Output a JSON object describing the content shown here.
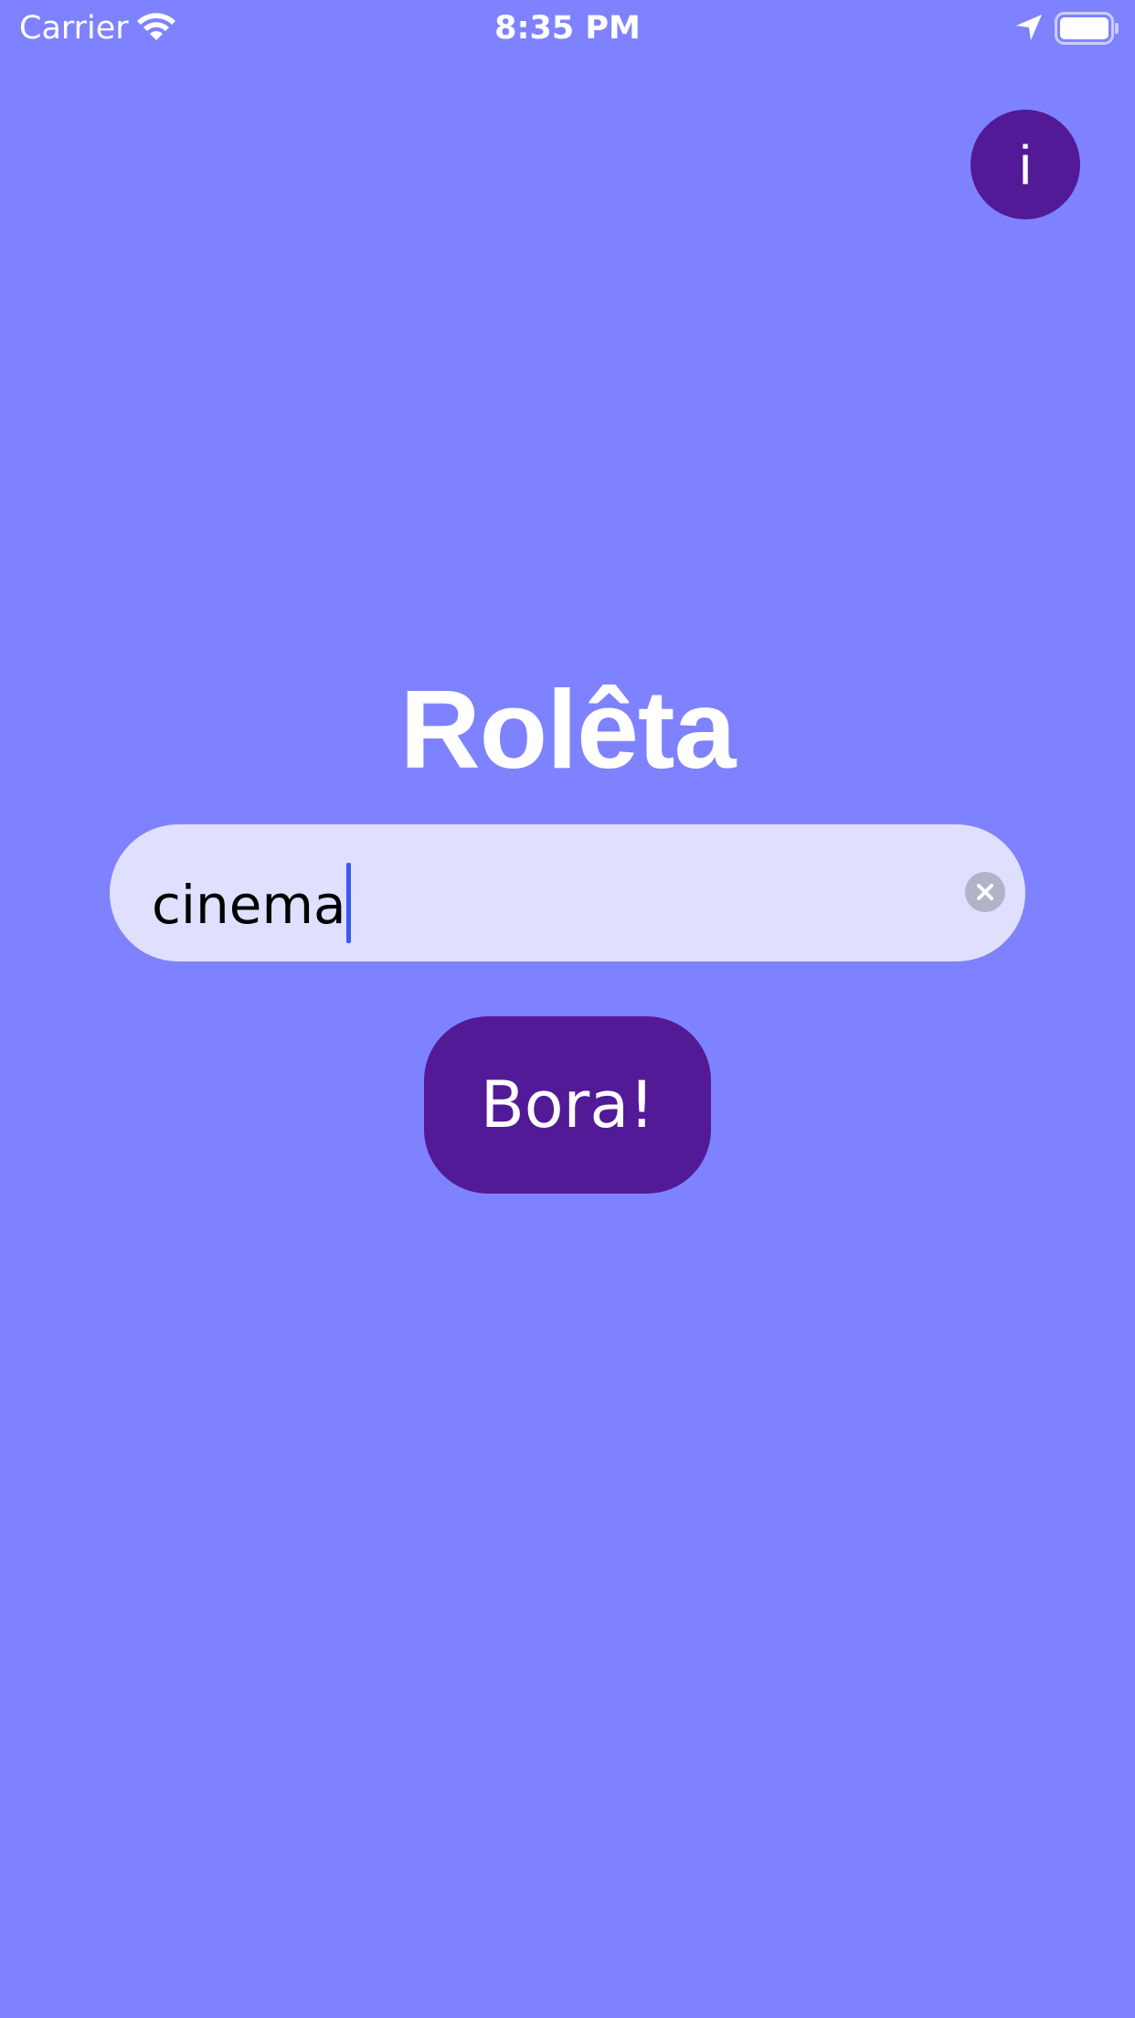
{
  "status_bar": {
    "carrier": "Carrier",
    "time": "8:35 PM",
    "icons": [
      "wifi-icon",
      "location-arrow-icon",
      "battery-icon"
    ]
  },
  "info_button": {
    "label": "i",
    "icon": "info-icon"
  },
  "title": "Rolêta",
  "search": {
    "value": "cinema",
    "clear_icon": "clear-circle-x-icon"
  },
  "action_button": {
    "label": "Bora!"
  },
  "colors": {
    "background": "#7f82ff",
    "accent": "#521a96",
    "field_background": "#dfe0fe",
    "caret": "#3a5af0",
    "text_light": "#ffffff"
  }
}
